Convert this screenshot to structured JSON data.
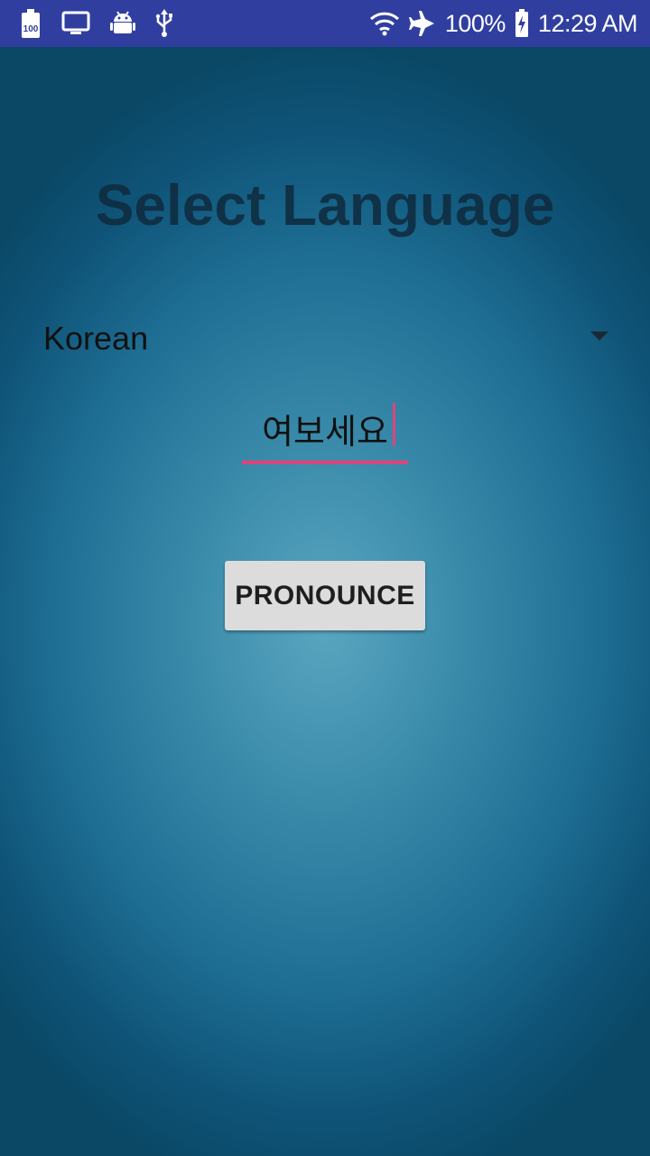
{
  "status_bar": {
    "battery_percent": "100%",
    "time": "12:29 AM",
    "background_color": "#303f9f",
    "left_icons": [
      "battery-100-icon",
      "monitor-icon",
      "android-icon",
      "usb-icon"
    ],
    "right_icons": [
      "wifi-icon",
      "airplane-icon",
      "battery-charging-icon"
    ]
  },
  "main": {
    "title": "Select Language",
    "language_selected": "Korean",
    "phrase_value": "여보세요",
    "pronounce_label": "PRONOUNCE",
    "accent_color": "#e0437a"
  }
}
